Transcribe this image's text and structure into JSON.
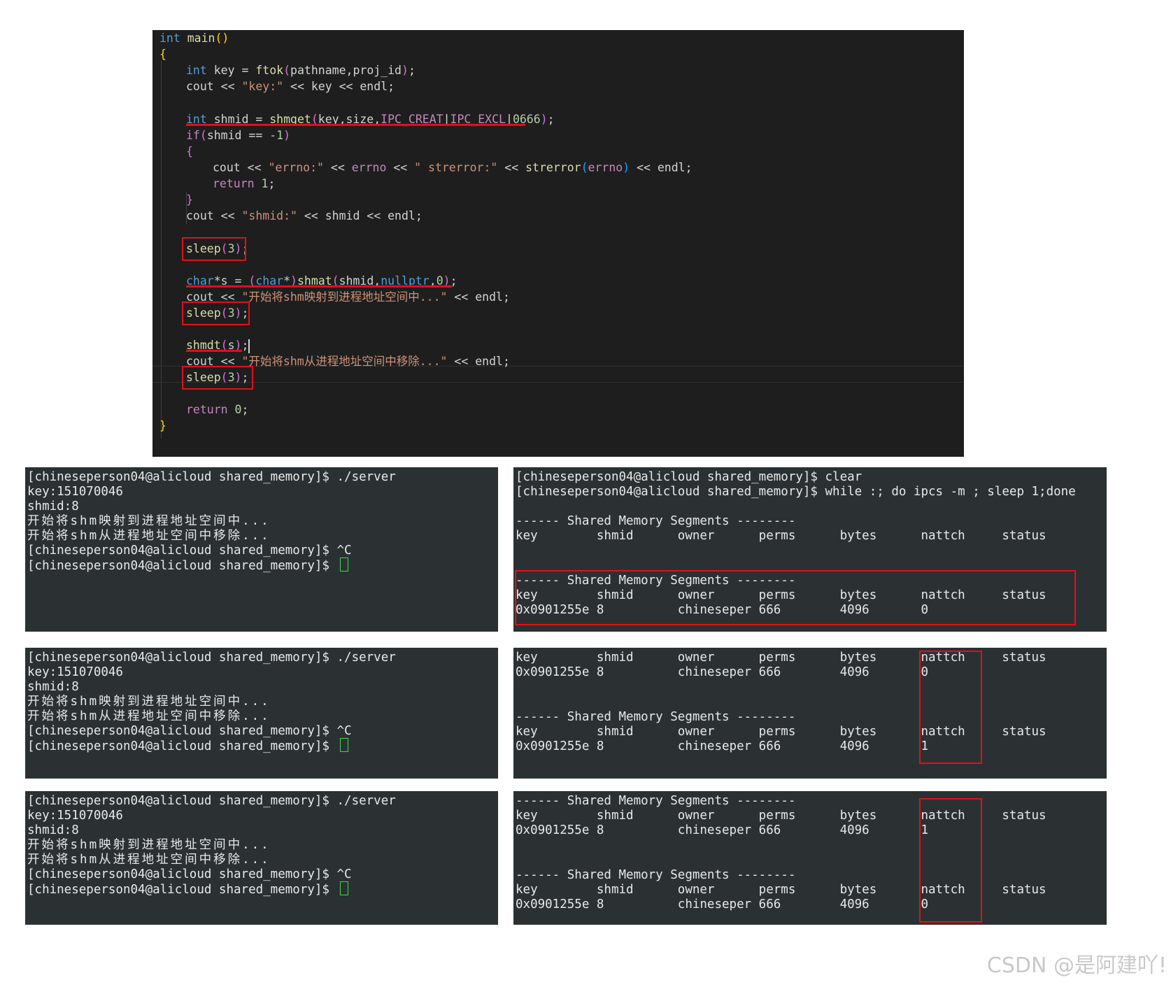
{
  "code": {
    "lines": [
      "int main()",
      "{",
      "int key = ftok(pathname,proj_id);",
      "cout << \"key:\" << key << endl;",
      "int shmid = shmget(key,size,IPC_CREAT|IPC_EXCL|0666);",
      "if(shmid == -1)",
      "{",
      "cout << \"errno:\" << errno << \" strerror:\" << strerror(errno) << endl;",
      "return 1;",
      "}",
      "cout << \"shmid:\" << shmid << endl;",
      "sleep(3);",
      "char*s = (char*)shmat(shmid,nullptr,0);",
      "cout << \"开始将shm映射到进程地址空间中...\" << endl;",
      "sleep(3);",
      "shmdt(s);",
      "cout << \"开始将shm从进程地址空间中移除...\" << endl;",
      "sleep(3);",
      "return 0;",
      "}"
    ]
  },
  "terminal_left": {
    "lines": [
      "[chineseperson04@alicloud shared_memory]$ ./server",
      "key:151070046",
      "shmid:8",
      "开始将shm映射到进程地址空间中...",
      "开始将shm从进程地址空间中移除...",
      "[chineseperson04@alicloud shared_memory]$ ^C",
      "[chineseperson04@alicloud shared_memory]$ "
    ]
  },
  "terminal_right_1": {
    "prompt_clear": "[chineseperson04@alicloud shared_memory]$ clear",
    "prompt_while": "[chineseperson04@alicloud shared_memory]$ while :; do ipcs -m ; sleep 1;done",
    "seg_title": "------ Shared Memory Segments --------",
    "header": "key        shmid      owner      perms      bytes      nattch     status",
    "row_nattch0": "0x0901255e 8          chineseper 666        4096       0"
  },
  "terminal_right_2": {
    "header": "key        shmid      owner      perms      bytes      nattch     status",
    "row_a": "0x0901255e 8          chineseper 666        4096       0",
    "seg_title": "------ Shared Memory Segments --------",
    "row_b": "0x0901255e 8          chineseper 666        4096       1"
  },
  "terminal_right_3": {
    "seg_title": "------ Shared Memory Segments --------",
    "header": "key        shmid      owner      perms      bytes      nattch     status",
    "row_a": "0x0901255e 8          chineseper 666        4096       1",
    "row_b": "0x0901255e 8          chineseper 666        4096       0"
  },
  "watermark": "CSDN @是阿建吖!",
  "colors": {
    "editor_bg": "#1e1e1e",
    "terminal_bg": "#2b3133",
    "annotation_red": "#e0101a",
    "cursor_green": "#3dd94a"
  }
}
